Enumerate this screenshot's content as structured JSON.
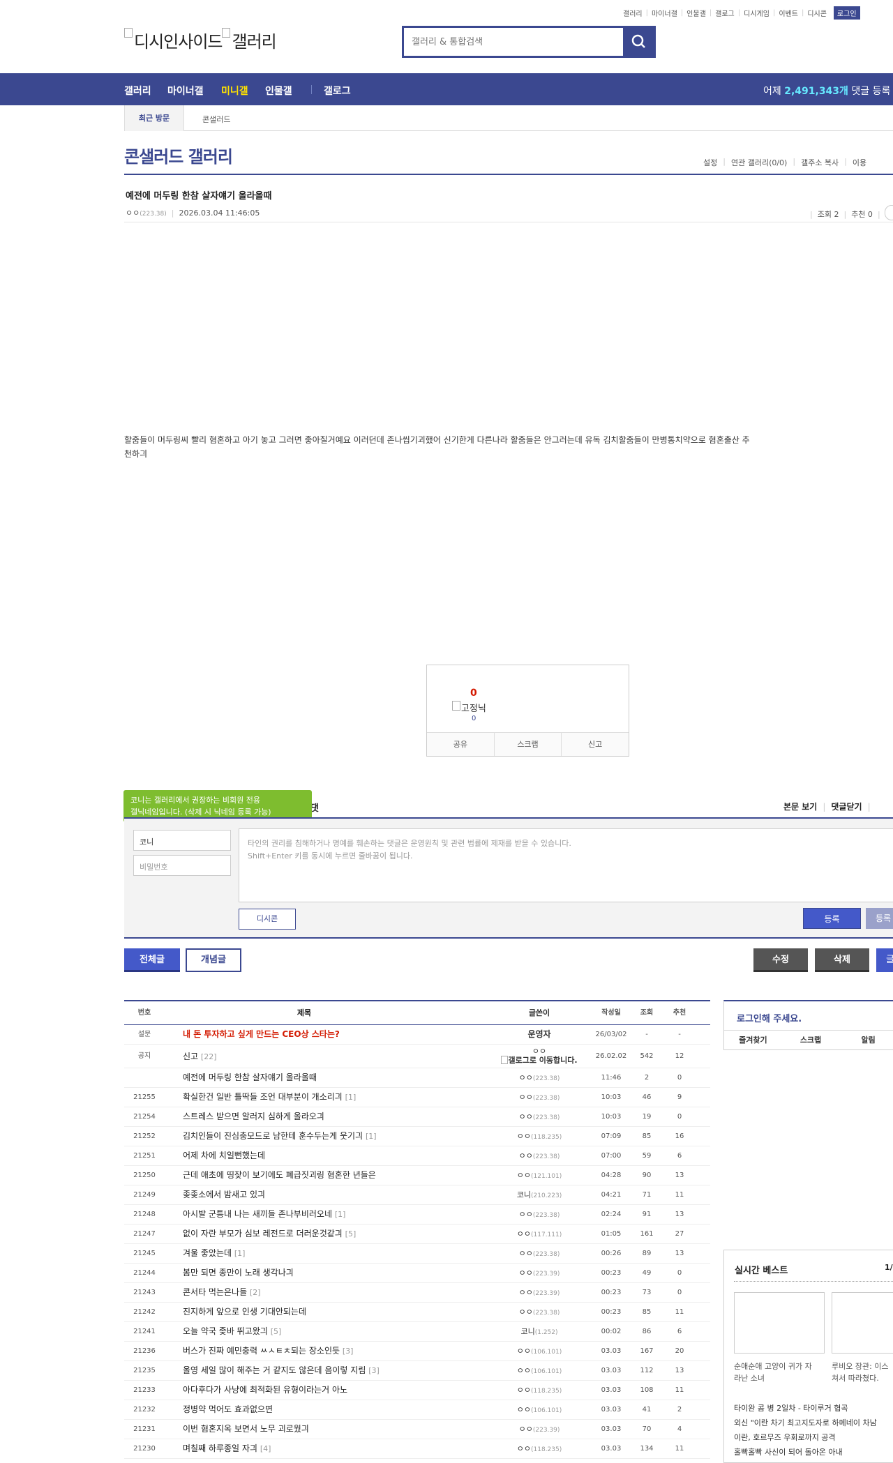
{
  "top_links": [
    "갤러리",
    "마이너갤",
    "인물갤",
    "갤로그",
    "디시게임",
    "이벤트",
    "디시콘"
  ],
  "login_label": "로그인",
  "logo": {
    "part1": "디시인사이드",
    "part2": "갤러리"
  },
  "search": {
    "placeholder": "갤러리 & 통합검색"
  },
  "nav": {
    "items": [
      "갤러리",
      "마이너갤",
      "미니갤",
      "인물갤",
      "갤로그"
    ],
    "active": "미니갤",
    "stat_prefix": "어제",
    "stat_count": "2,491,343개",
    "stat_suffix": "댓글 등록"
  },
  "recent": {
    "tab": "최근 방문",
    "item": "콘샐러드"
  },
  "gallery": {
    "title": "콘샐러드 갤러리",
    "options": [
      "설정",
      "연관 갤러리(0/0)",
      "갤주소 복사",
      "이용"
    ]
  },
  "post": {
    "title": "예전에 머두링 한참 살자얘기 올라올때",
    "author": "ㅇㅇ",
    "author_ip": "(223.38)",
    "datetime": "2026.03.04 11:46:05",
    "views": "조회 2",
    "recommend": "추천 0",
    "body": "할줌들이 머두링씨 빨리 혐혼하고 아기 놓고 그러면 좋아질거예요 이러던데 존나씹기괴했어 신기한게 다른나라 할줌들은 안그러는데 유독 김치할줌들이 만병통치약으로 혐혼출산 추천하긔"
  },
  "recommend_box": {
    "count": "0",
    "fixed_nick": "고정닉",
    "fixed_count": "0",
    "buttons": [
      "공유",
      "스크랩",
      "신고"
    ]
  },
  "comment": {
    "tooltip_line1": "코니는 갤러리에서 권장하는 비회원 전용",
    "tooltip_line2": "갤닉네임입니다. (삭제 시 닉네임 등록 가능)",
    "title_fragment": "댓",
    "view_post": "본문 보기",
    "close_comments": "댓글닫기",
    "nickname_value": "코니",
    "password_placeholder": "비밀번호",
    "textarea_line1": "타인의 권리를 침해하거나 명예를 훼손하는 댓글은 운영원칙 및 관련 법률에 제재를 받을 수 있습니다.",
    "textarea_line2": "Shift+Enter 키를 동시에 누르면 줄바꿈이 됩니다.",
    "dccon": "디시콘",
    "submit": "등록",
    "submit2": "등록"
  },
  "list_buttons": {
    "all": "전체글",
    "concept": "개념글",
    "edit": "수정",
    "delete": "삭제",
    "write": "글"
  },
  "table": {
    "headers": {
      "num": "번호",
      "title": "제목",
      "writer": "글쓴이",
      "date": "작성일",
      "views": "조회",
      "rec": "추천"
    },
    "rows": [
      {
        "num": "설문",
        "title": "내 돈 투자하고 싶게 만드는 CEO상 스타는?",
        "rc": "",
        "writer": "운영자",
        "ip": "",
        "date": "26/03/02",
        "views": "-",
        "rec": "-",
        "notice": true
      },
      {
        "num": "공지",
        "title": "신고",
        "rc": "[22]",
        "writer": "ㅇㅇ",
        "ip": "갤로그로 이동합니다.",
        "date": "26.02.02",
        "views": "542",
        "rec": "12",
        "notice": false,
        "special": true
      },
      {
        "num": "",
        "title": "예전에 머두링 한참 살자얘기 올라올때",
        "rc": "",
        "writer": "ㅇㅇ",
        "ip": "(223.38)",
        "date": "11:46",
        "views": "2",
        "rec": "0"
      },
      {
        "num": "21255",
        "title": "확실한건 일반 틀딱들 조언 대부분이 개소리긔",
        "rc": "[1]",
        "writer": "ㅇㅇ",
        "ip": "(223.38)",
        "date": "10:03",
        "views": "46",
        "rec": "9"
      },
      {
        "num": "21254",
        "title": "스트레스 받으면 알러지 심하게 올라오긔",
        "rc": "",
        "writer": "ㅇㅇ",
        "ip": "(223.38)",
        "date": "10:03",
        "views": "19",
        "rec": "0"
      },
      {
        "num": "21252",
        "title": "김치인들이 진심충모드로 남한테 훈수두는게 웃기긔",
        "rc": "[1]",
        "writer": "ㅇㅇ",
        "ip": "(118.235)",
        "date": "07:09",
        "views": "85",
        "rec": "16"
      },
      {
        "num": "21251",
        "title": "어제 차에 치일뻔했는데",
        "rc": "",
        "writer": "ㅇㅇ",
        "ip": "(223.38)",
        "date": "07:00",
        "views": "59",
        "rec": "6"
      },
      {
        "num": "21250",
        "title": "근데 애초에 띵잦이 보기에도 폐급짓괴링 혐혼한 년들은",
        "rc": "",
        "writer": "ㅇㅇ",
        "ip": "(121.101)",
        "date": "04:28",
        "views": "90",
        "rec": "13"
      },
      {
        "num": "21249",
        "title": "좆좆소에서 밤새고 있긔",
        "rc": "",
        "writer": "코니",
        "ip": "(210.223)",
        "date": "04:21",
        "views": "71",
        "rec": "11"
      },
      {
        "num": "21248",
        "title": "아시발 군틍내 나는 새끼들 존나부비러오네",
        "rc": "[1]",
        "writer": "ㅇㅇ",
        "ip": "(223.38)",
        "date": "02:24",
        "views": "91",
        "rec": "13"
      },
      {
        "num": "21247",
        "title": "없이 자란 부모가 심보 레전드로 더러운것같긔",
        "rc": "[5]",
        "writer": "ㅇㅇ",
        "ip": "(117.111)",
        "date": "01:05",
        "views": "161",
        "rec": "27"
      },
      {
        "num": "21245",
        "title": "겨울 좋았는데",
        "rc": "[1]",
        "writer": "ㅇㅇ",
        "ip": "(223.38)",
        "date": "00:26",
        "views": "89",
        "rec": "13"
      },
      {
        "num": "21244",
        "title": "봄만 되면 종만이 노래 생각나긔",
        "rc": "",
        "writer": "ㅇㅇ",
        "ip": "(223.39)",
        "date": "00:23",
        "views": "49",
        "rec": "0"
      },
      {
        "num": "21243",
        "title": "콘서타 먹는은나들",
        "rc": "[2]",
        "writer": "ㅇㅇ",
        "ip": "(223.39)",
        "date": "00:23",
        "views": "73",
        "rec": "0"
      },
      {
        "num": "21242",
        "title": "진지하게 앞으로 인생 기대안되는데",
        "rc": "",
        "writer": "ㅇㅇ",
        "ip": "(223.38)",
        "date": "00:23",
        "views": "85",
        "rec": "11"
      },
      {
        "num": "21241",
        "title": "오늘 약국 좆바 뛰고왔긔",
        "rc": "[5]",
        "writer": "코니",
        "ip": "(1.252)",
        "date": "00:02",
        "views": "86",
        "rec": "6"
      },
      {
        "num": "21236",
        "title": "버스가 진짜 예민충력 ㅆㅅㅌㅊ되는 장소인듯",
        "rc": "[3]",
        "writer": "ㅇㅇ",
        "ip": "(106.101)",
        "date": "03.03",
        "views": "167",
        "rec": "20"
      },
      {
        "num": "21235",
        "title": "올영 세일 많이 해주는 거 같지도 않은데 음이렇 지림",
        "rc": "[3]",
        "writer": "ㅇㅇ",
        "ip": "(106.101)",
        "date": "03.03",
        "views": "112",
        "rec": "13"
      },
      {
        "num": "21233",
        "title": "아다후다가 사냥에 최적화된 유형이라는거 아노",
        "rc": "",
        "writer": "ㅇㅇ",
        "ip": "(118.235)",
        "date": "03.03",
        "views": "108",
        "rec": "11"
      },
      {
        "num": "21232",
        "title": "정병약 먹어도 효과없으면",
        "rc": "",
        "writer": "ㅇㅇ",
        "ip": "(106.101)",
        "date": "03.03",
        "views": "41",
        "rec": "2"
      },
      {
        "num": "21231",
        "title": "이번 혐혼지옥 보면서 노무 괴로웠긔",
        "rc": "",
        "writer": "ㅇㅇ",
        "ip": "(223.39)",
        "date": "03.03",
        "views": "70",
        "rec": "4"
      },
      {
        "num": "21230",
        "title": "며칠째 하루종일 자긔",
        "rc": "[4]",
        "writer": "ㅇㅇ",
        "ip": "(118.235)",
        "date": "03.03",
        "views": "134",
        "rec": "11"
      }
    ]
  },
  "login_box": {
    "title": "로그인해 주세요.",
    "buttons": [
      "즐겨찾기",
      "스크랩",
      "알림"
    ]
  },
  "best": {
    "title": "실시간 베스트",
    "page": "1/",
    "captions": [
      {
        "l1": "순애순애 고양이 귀가 자",
        "l2": "라난 소녀"
      },
      {
        "l1": "루비오 장관: 이스",
        "l2": "쳐서 따라쳤다."
      }
    ],
    "items": [
      "타이완 콤 병 2일차 - 타이루거 협곡",
      "외신 \"이란 차기 최고지도자로 하메네이 차남",
      "이란, 호르무즈 우회로까지 공격",
      "홀빡홀빡 사신이 되어 돌아온 아내"
    ]
  }
}
